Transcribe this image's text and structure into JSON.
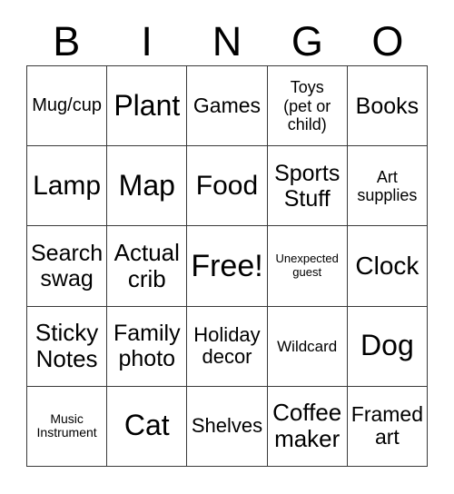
{
  "card": {
    "title_letters": [
      "B",
      "I",
      "N",
      "G",
      "O"
    ],
    "background_color": "#ffffff",
    "text_color": "#000000",
    "border_color": "#3a3a3a",
    "rows": 5,
    "columns": 5,
    "free_space_label": "Free!",
    "free_space_position": {
      "row": 3,
      "column": 3
    }
  },
  "cells": [
    {
      "text": "Mug/cup",
      "size": "fs-20",
      "column": "B",
      "row": 1
    },
    {
      "text": "Plant",
      "size": "fs-32",
      "column": "I",
      "row": 1
    },
    {
      "text": "Games",
      "size": "fs-23",
      "column": "N",
      "row": 1
    },
    {
      "text": "Toys\n(pet or\nchild)",
      "size": "fs-18",
      "column": "G",
      "row": 1
    },
    {
      "text": "Books",
      "size": "fs-25",
      "column": "O",
      "row": 1
    },
    {
      "text": "Lamp",
      "size": "fs-30",
      "column": "B",
      "row": 2
    },
    {
      "text": "Map",
      "size": "fs-32",
      "column": "I",
      "row": 2
    },
    {
      "text": "Food",
      "size": "fs-30",
      "column": "N",
      "row": 2
    },
    {
      "text": "Sports\nStuff",
      "size": "fs-25",
      "column": "G",
      "row": 2
    },
    {
      "text": "Art\nsupplies",
      "size": "fs-18",
      "column": "O",
      "row": 2
    },
    {
      "text": "Search\nswag",
      "size": "fs-25",
      "column": "B",
      "row": 3
    },
    {
      "text": "Actual\ncrib",
      "size": "fs-26",
      "column": "I",
      "row": 3
    },
    {
      "text": "Free!",
      "size": "fs-34",
      "column": "N",
      "row": 3
    },
    {
      "text": "Unexpected\nguest",
      "size": "fs-13",
      "column": "G",
      "row": 3
    },
    {
      "text": "Clock",
      "size": "fs-28",
      "column": "O",
      "row": 3
    },
    {
      "text": "Sticky\nNotes",
      "size": "fs-26",
      "column": "B",
      "row": 4
    },
    {
      "text": "Family\nphoto",
      "size": "fs-25",
      "column": "I",
      "row": 4
    },
    {
      "text": "Holiday\ndecor",
      "size": "fs-22",
      "column": "N",
      "row": 4
    },
    {
      "text": "Wildcard",
      "size": "fs-17",
      "column": "G",
      "row": 4
    },
    {
      "text": "Dog",
      "size": "fs-32",
      "column": "O",
      "row": 4
    },
    {
      "text": "Music\nInstrument",
      "size": "fs-14",
      "column": "B",
      "row": 5
    },
    {
      "text": "Cat",
      "size": "fs-32",
      "column": "I",
      "row": 5
    },
    {
      "text": "Shelves",
      "size": "fs-22",
      "column": "N",
      "row": 5
    },
    {
      "text": "Coffee\nmaker",
      "size": "fs-26",
      "column": "G",
      "row": 5
    },
    {
      "text": "Framed\nart",
      "size": "fs-23",
      "column": "O",
      "row": 5
    }
  ]
}
